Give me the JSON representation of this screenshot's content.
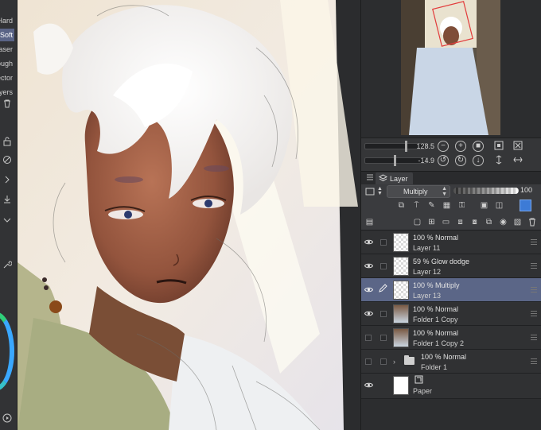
{
  "tool_strip": {
    "subtools": [
      "Hard",
      "Soft",
      "Eraser",
      "Rough",
      "Vector",
      "Layers"
    ],
    "selected": "Soft"
  },
  "navigator": {
    "zoom_value": "128.5",
    "rotate_value": "-14.9"
  },
  "layer_panel": {
    "tab_label": "Layer",
    "blend_mode": "Multiply",
    "opacity": "100"
  },
  "layers": [
    {
      "mode": "100 % Normal",
      "name": "Layer 11",
      "visible": true,
      "selected": false
    },
    {
      "mode": "59 % Glow dodge",
      "name": "Layer 12",
      "visible": true,
      "selected": false
    },
    {
      "mode": "100 % Multiply",
      "name": "Layer 13",
      "visible": true,
      "selected": true
    },
    {
      "mode": "100 % Normal",
      "name": "Folder 1 Copy",
      "visible": true,
      "selected": false
    },
    {
      "mode": "100 % Normal",
      "name": "Folder 1 Copy 2",
      "visible": false,
      "selected": false
    },
    {
      "mode": "100 % Normal",
      "name": "Folder 1",
      "visible": false,
      "selected": false
    },
    {
      "mode": "",
      "name": "Paper",
      "visible": true,
      "selected": false
    }
  ],
  "colors": {
    "selection": "#5b6687",
    "panel_bg": "#353638",
    "accent_ring": "#2fd07a"
  }
}
